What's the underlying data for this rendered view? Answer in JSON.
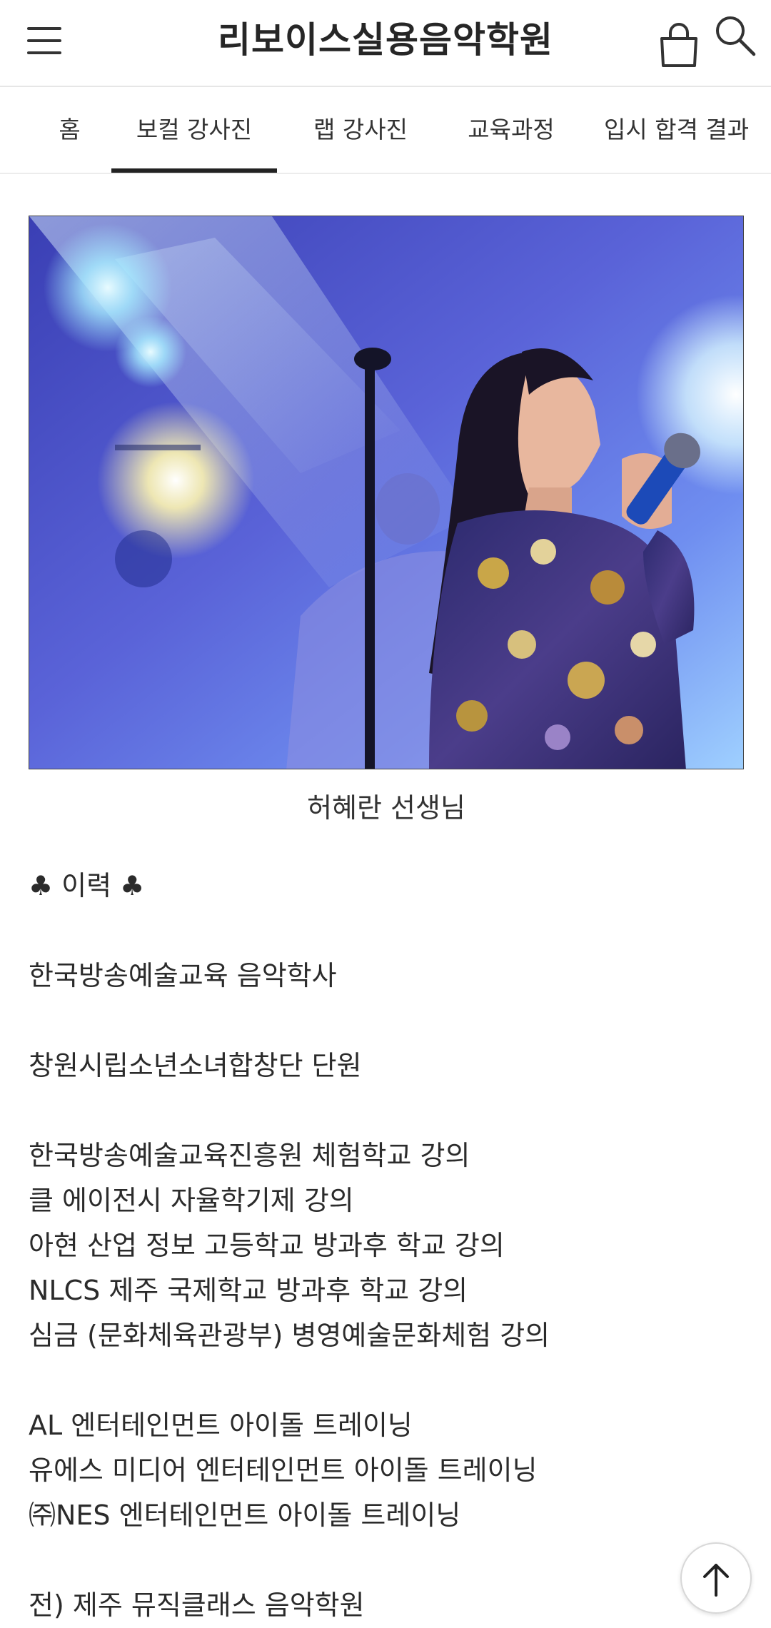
{
  "header": {
    "title": "리보이스실용음악학원",
    "menu_icon": "hamburger-menu-icon",
    "cart_icon": "shopping-bag-icon",
    "search_icon": "search-icon"
  },
  "nav": {
    "tabs": [
      {
        "label": "홈",
        "active": false
      },
      {
        "label": "보컬 강사진",
        "active": true
      },
      {
        "label": "랩 강사진",
        "active": false
      },
      {
        "label": "교육과정",
        "active": false
      },
      {
        "label": "입시 합격 결과",
        "active": false
      }
    ]
  },
  "teacher": {
    "name": "허혜란 선생님"
  },
  "bio": {
    "heading": "♣ 이력 ♣",
    "education": "한국방송예술교육 음악학사",
    "choir": "창원시립소년소녀합창단 단원",
    "lectures": [
      "한국방송예술교육진흥원 체험학교 강의",
      "클 에이전시 자율학기제 강의",
      "아현 산업 정보 고등학교 방과후 학교 강의",
      "NLCS 제주 국제학교 방과후 학교 강의",
      "심금 (문화체육관광부) 병영예술문화체험 강의"
    ],
    "training": [
      "AL 엔터테인먼트 아이돌 트레이닝",
      "유에스 미디어 엔터테인먼트 아이돌 트레이닝",
      "㈜NES 엔터테인먼트 아이돌 트레이닝"
    ],
    "former": "전) 제주 뮤직클래스 음악학원"
  },
  "scroll_top": {
    "icon": "arrow-up-icon"
  }
}
